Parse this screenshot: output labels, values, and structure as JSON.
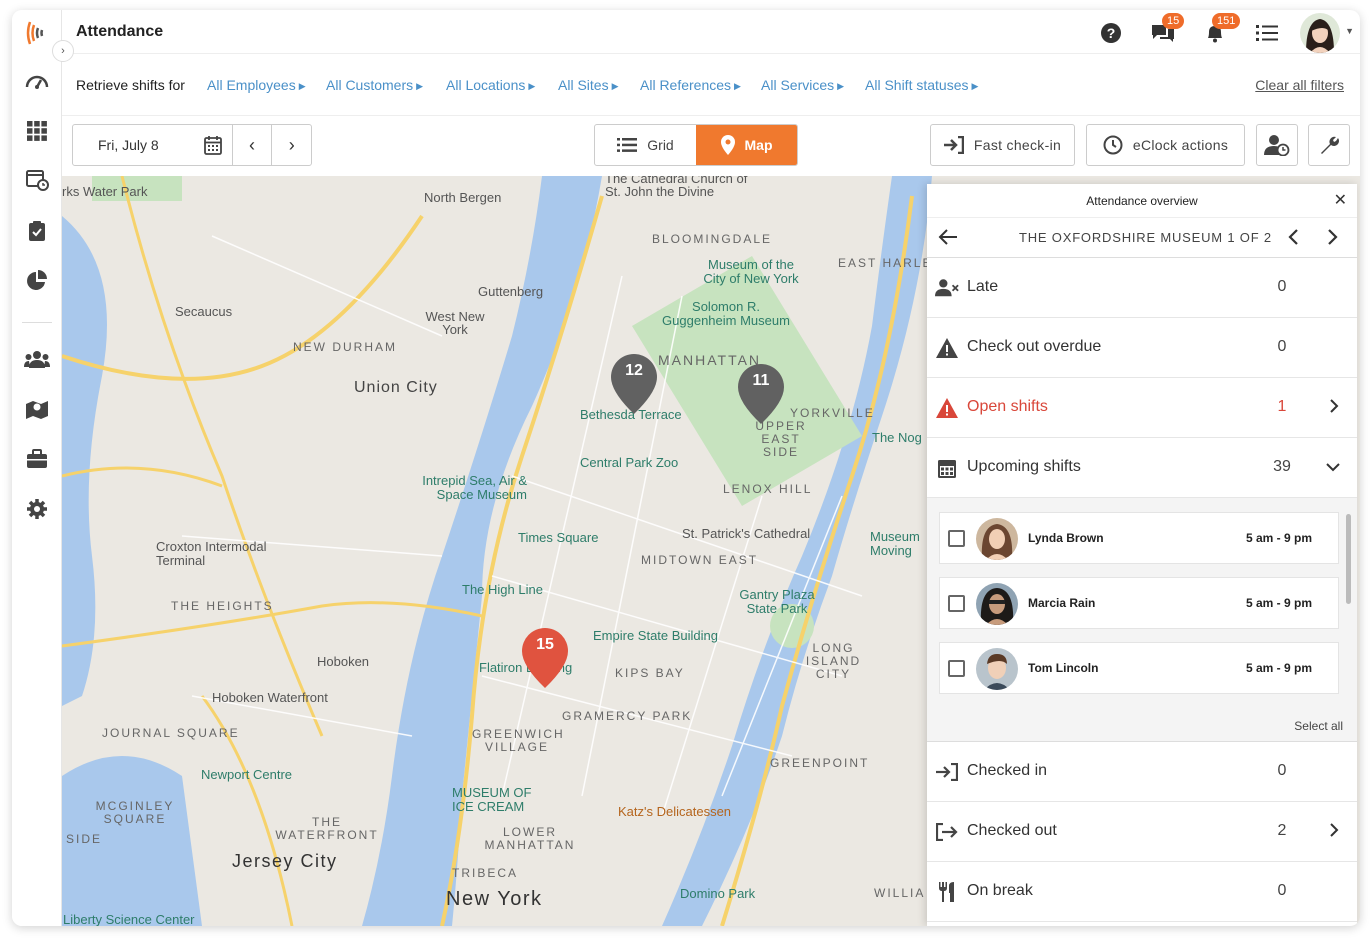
{
  "header": {
    "title": "Attendance",
    "chat_badge": "15",
    "notif_badge": "151"
  },
  "filters": {
    "label": "Retrieve shifts for",
    "items": [
      "All Employees",
      "All Customers",
      "All Locations",
      "All Sites",
      "All References",
      "All Services",
      "All Shift statuses"
    ],
    "clear": "Clear all filters"
  },
  "toolbar": {
    "date": "Fri, July 8",
    "grid_label": "Grid",
    "map_label": "Map",
    "fast_checkin": "Fast check-in",
    "eclock": "eClock actions"
  },
  "map": {
    "places": {
      "north_bergen": "North Bergen",
      "guttenberg": "Guttenberg",
      "west_new_york": "West New York",
      "secaucus": "Secaucus",
      "new_durham": "NEW DURHAM",
      "union_city": "Union City",
      "the_heights": "THE HEIGHTS",
      "hoboken": "Hoboken",
      "journal_square": "JOURNAL SQUARE",
      "mcginley_square": "MCGINLEY SQUARE",
      "the_waterfront": "THE WATERFRONT",
      "jersey_city": "Jersey City",
      "new_york": "New York",
      "tribeca": "TRIBECA",
      "lower_manhattan": "LOWER MANHATTAN",
      "greenwich_village": "GREENWICH VILLAGE",
      "gramercy_park": "GRAMERCY PARK",
      "kips_bay": "KIPS BAY",
      "midtown_east": "MIDTOWN EAST",
      "lenox_hill": "LENOX HILL",
      "upper_east_side": "UPPER EAST SIDE",
      "yorkville": "YORKVILLE",
      "bloomingdale": "BLOOMINGDALE",
      "east_harlem": "EAST HARLE",
      "greenpoint": "GREENPOINT",
      "long_island_city": "LONG ISLAND CITY",
      "manhattan": "MANHATTAN",
      "side": "SIDE",
      "williams": "WILLIA"
    },
    "pois": {
      "cathedral": "The Cathedral Church of St. John the Divine",
      "museum_city_ny": "Museum of the City of New York",
      "guggenheim": "Solomon R. Guggenheim Museum",
      "bethesda": "Bethesda Terrace",
      "central_park_zoo": "Central Park Zoo",
      "intrepid": "Intrepid Sea, Air & Space Museum",
      "times_square": "Times Square",
      "st_patricks": "St. Patrick's Cathedral",
      "croxton": "Croxton Intermodal Terminal",
      "high_line": "The High Line",
      "esb": "Empire State Building",
      "gantry": "Gantry Plaza State Park",
      "flatiron": "Flatiron Building",
      "hoboken_wf": "Hoboken Waterfront",
      "newport": "Newport Centre",
      "ice_cream": "MUSEUM OF ICE CREAM",
      "katz": "Katz's Delicatessen",
      "domino": "Domino Park",
      "liberty": "Liberty Science Center",
      "water_park": "rks Water Park",
      "museum_moving": "Museum Moving",
      "the_nog": "The Nog"
    },
    "pins": [
      {
        "label": "12",
        "color": "#616161"
      },
      {
        "label": "11",
        "color": "#616161"
      },
      {
        "label": "15",
        "color": "#e0533f"
      }
    ]
  },
  "panel": {
    "title": "Attendance overview",
    "site": "THE OXFORDSHIRE MUSEUM 1 OF 2",
    "rows": {
      "late": {
        "label": "Late",
        "value": "0"
      },
      "overdue": {
        "label": "Check out overdue",
        "value": "0"
      },
      "open": {
        "label": "Open shifts",
        "value": "1"
      },
      "upcoming": {
        "label": "Upcoming shifts",
        "value": "39"
      },
      "checked_in": {
        "label": "Checked in",
        "value": "0"
      },
      "checked_out": {
        "label": "Checked out",
        "value": "2"
      },
      "on_break": {
        "label": "On break",
        "value": "0"
      }
    },
    "shifts": [
      {
        "name": "Lynda Brown",
        "time": "5 am - 9 pm"
      },
      {
        "name": "Marcia Rain",
        "time": "5 am - 9 pm"
      },
      {
        "name": "Tom Lincoln",
        "time": "5 am - 9 pm"
      }
    ],
    "select_all": "Select all"
  },
  "colors": {
    "accent": "#f0792e",
    "link": "#4a90c8",
    "alert": "#d9473a"
  }
}
